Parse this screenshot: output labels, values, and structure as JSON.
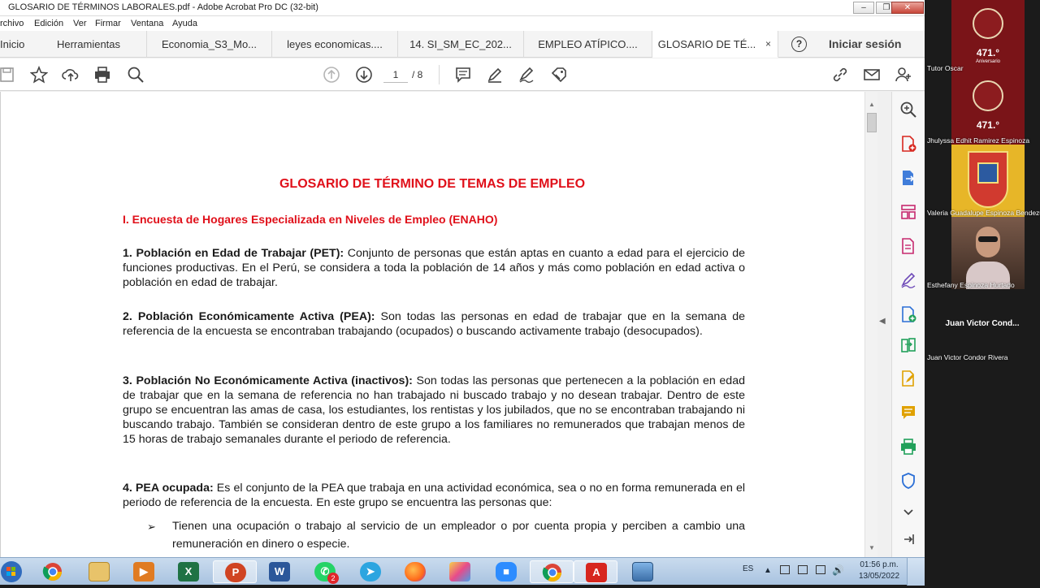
{
  "window": {
    "title": "GLOSARIO DE TÉRMINOS LABORALES.pdf - Adobe Acrobat Pro DC (32-bit)"
  },
  "menu": [
    "rchivo",
    "Edición",
    "Ver",
    "Firmar",
    "Ventana",
    "Ayuda"
  ],
  "tabs": [
    {
      "label": "Inicio"
    },
    {
      "label": "Herramientas"
    },
    {
      "label": "Economia_S3_Mo..."
    },
    {
      "label": "leyes economicas...."
    },
    {
      "label": "14. SI_SM_EC_202..."
    },
    {
      "label": "EMPLEO ATÍPICO...."
    },
    {
      "label": "GLOSARIO DE TÉ...",
      "close": "×"
    }
  ],
  "header": {
    "help": "?",
    "signin": "Iniciar sesión"
  },
  "toolbar": {
    "page_current": "1",
    "page_total": "/ 8"
  },
  "document": {
    "title": "GLOSARIO DE TÉRMINO DE TEMAS DE EMPLEO",
    "section": "I. Encuesta de Hogares Especializada en Niveles de Empleo (ENAHO)",
    "items": [
      {
        "term": "1.   Población en Edad de Trabajar (PET):",
        "text": " Conjunto de personas que están aptas en cuanto a edad para el ejercicio de funciones productivas. En el Perú, se considera a toda la población de 14 años y más como población en edad activa o población en edad de trabajar."
      },
      {
        "term": "2.   Población Económicamente Activa (PEA):",
        "text": " Son todas las personas en edad de trabajar que en la semana de referencia de la encuesta se encontraban trabajando (ocupados) o buscando activamente trabajo (desocupados)."
      },
      {
        "term": "3.   Población No Económicamente Activa (inactivos):",
        "text": " Son todas las personas que pertenecen a la población en edad de trabajar que en la semana de referencia no han trabajado ni buscado trabajo y no desean trabajar. Dentro de este grupo se encuentran las amas de casa, los estudiantes, los rentistas y los jubilados, que no se encontraban trabajando ni buscando trabajo. También se consideran dentro de este grupo a los familiares no remunerados que trabajan menos de 15 horas de trabajo semanales durante el periodo de referencia."
      },
      {
        "term": "4.   PEA ocupada:",
        "text": " Es el conjunto de la PEA que trabaja en una actividad económica, sea o no en forma remunerada en el periodo de referencia de la encuesta. En este grupo se encuentra las personas que:"
      }
    ],
    "bullet_mark": "➢",
    "bullet_text": "Tienen una ocupación o trabajo al servicio de un empleador o por cuenta propia y perciben a cambio una remuneración en dinero o especie."
  },
  "taskbar": {
    "lang": "ES",
    "time": "01:56 p.m.",
    "date": "13/05/2022",
    "whatsapp_badge": "2",
    "excel": "X",
    "powerpoint": "P",
    "word": "W"
  },
  "meeting": {
    "participants": [
      {
        "name": "Tutor Oscar",
        "badge": "471.°",
        "badge_sub": "Aniversario"
      },
      {
        "name": "Jhulyssa Edhit Ramirez Espinoza",
        "badge": "471.°"
      },
      {
        "name": "Valeria Guadalupe Espinoza Bendezu"
      },
      {
        "name": "Esthefany Espinoza Hurtado"
      },
      {
        "name": "Juan Victor Condor Rivera",
        "display": "Juan Victor Cond..."
      }
    ]
  },
  "colors": {
    "heading_red": "#e0101a",
    "acrobat_red": "#d7261e",
    "emblem_red": "#7a1418"
  }
}
